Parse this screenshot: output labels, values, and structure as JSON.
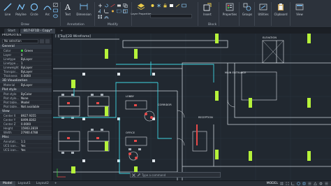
{
  "ribbon": {
    "draw_panel": "Draw",
    "annotation_panel": "Annotation",
    "modify_panel": "Modify",
    "block_panel": "Block",
    "tools": {
      "line": "Line",
      "polyline": "Polyline",
      "circle": "Circle",
      "arc": "Arc",
      "text": "Text",
      "dimension": "Dimension",
      "layer_properties": "Layer Properties",
      "insert": "Insert",
      "properties": "Properties",
      "groups": "Groups",
      "utilities": "Utilities",
      "clipboard": "Clipboard",
      "view": "View"
    }
  },
  "tabs": {
    "first": "Start",
    "active": "B17-EF1D - Copy*",
    "plus": "+"
  },
  "properties": {
    "title": "PROPERTIES",
    "selection": "No selection",
    "sections": {
      "general": "General",
      "viz": "3D Visualization",
      "plot": "Plot style",
      "view": "View",
      "misc": "Misc"
    },
    "general_rows": [
      {
        "k": "Color",
        "v": "Green",
        "sw": "#3ccf3c"
      },
      {
        "k": "Layer",
        "v": "0"
      },
      {
        "k": "Linetype",
        "v": "ByLayer"
      },
      {
        "k": "Linetype...",
        "v": "1"
      },
      {
        "k": "Lineweight",
        "v": "ByLayer"
      },
      {
        "k": "Transpar...",
        "v": "ByLayer"
      },
      {
        "k": "Thickness",
        "v": "0.0000"
      }
    ],
    "viz_rows": [
      {
        "k": "Material",
        "v": "ByLayer"
      }
    ],
    "plot_rows": [
      {
        "k": "Plot style",
        "v": "ByColor"
      },
      {
        "k": "Plot style...",
        "v": "None"
      },
      {
        "k": "Plot table...",
        "v": "Model"
      },
      {
        "k": "Plot table...",
        "v": "Not available"
      }
    ],
    "view_rows": [
      {
        "k": "Center X",
        "v": "8927.9355"
      },
      {
        "k": "Center Y",
        "v": "8499.8302"
      },
      {
        "k": "Center Z",
        "v": "0.0000"
      },
      {
        "k": "Height",
        "v": "15903.2819"
      },
      {
        "k": "Width",
        "v": "27900.4788"
      }
    ],
    "misc_rows": [
      {
        "k": "Annotati...",
        "v": "1:1"
      },
      {
        "k": "UCS icon...",
        "v": "Yes"
      },
      {
        "k": "UCS icon...",
        "v": "Yes"
      }
    ]
  },
  "drawing": {
    "view_label": "[-][Top][2D Wireframe]",
    "labels": {
      "main_entrance": "MAIN ENTRANCE",
      "reception": "RECEPTION",
      "elevation": "ELEVATION",
      "lobby": "LOBBY",
      "office": "OFFICE",
      "corridor": "CORRIDOR"
    }
  },
  "command": {
    "placeholder": "Type a command"
  },
  "status": {
    "layouts": [
      "Model",
      "Layout1",
      "Layout2",
      "+"
    ],
    "space": "MODEL"
  },
  "colors": {
    "accent_green": "#b6f23a",
    "cyan": "#3fd3e0",
    "red": "#e84a4a"
  }
}
